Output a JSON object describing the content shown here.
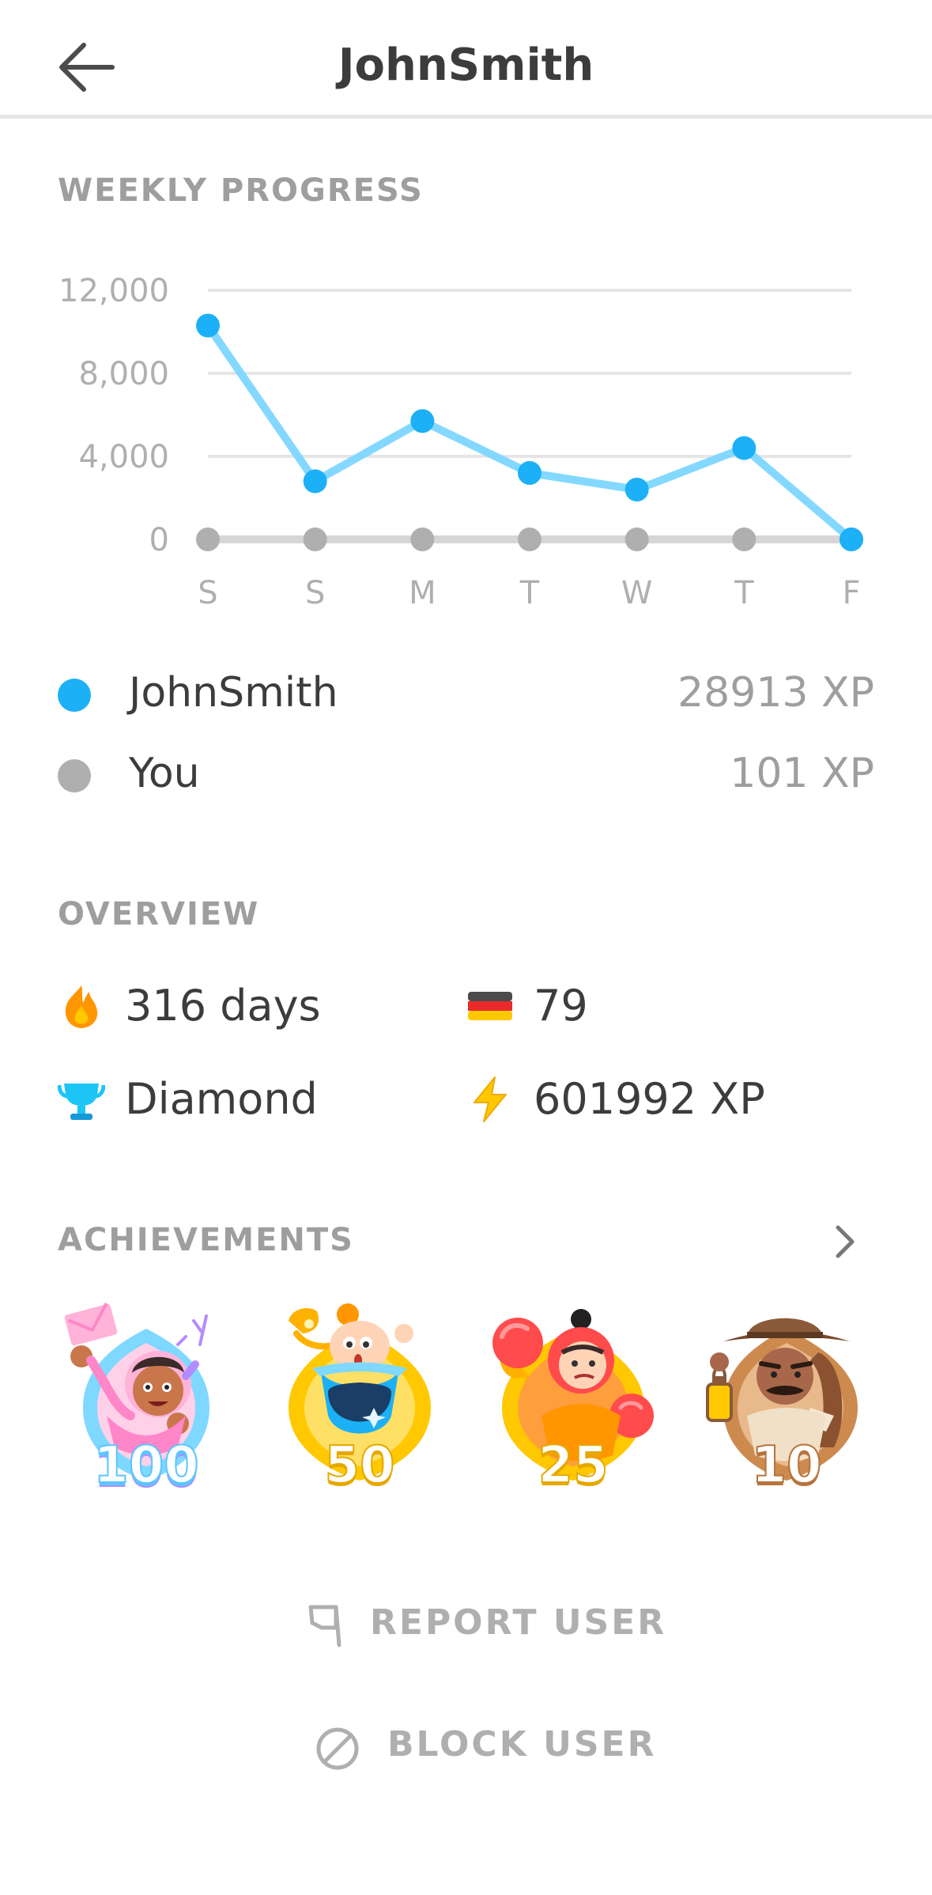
{
  "header": {
    "title": "JohnSmith",
    "back_icon": "arrow-left-icon"
  },
  "weekly_progress": {
    "label": "WEEKLY PROGRESS",
    "legend": [
      {
        "name": "JohnSmith",
        "xp": "28913 XP",
        "color": "#1cb0f6"
      },
      {
        "name": "You",
        "xp": "101 XP",
        "color": "#afafaf"
      }
    ]
  },
  "chart_data": {
    "type": "line",
    "categories": [
      "S",
      "S",
      "M",
      "T",
      "W",
      "T",
      "F"
    ],
    "y_ticks": [
      "12,000",
      "8,000",
      "4,000",
      "0"
    ],
    "ylim": [
      0,
      12000
    ],
    "grid": true,
    "series": [
      {
        "name": "JohnSmith",
        "color": "#1cb0f6",
        "line_color": "#84d8ff",
        "values": [
          10300,
          2800,
          5700,
          3200,
          2400,
          4400,
          0
        ]
      },
      {
        "name": "You",
        "color": "#afafaf",
        "line_color": "#d6d6d6",
        "values": [
          0,
          0,
          0,
          0,
          0,
          0,
          0
        ]
      }
    ]
  },
  "overview": {
    "label": "OVERVIEW",
    "stats": [
      {
        "icon": "fire-icon",
        "text": "316 days"
      },
      {
        "icon": "germany-flag-icon",
        "text": "79"
      },
      {
        "icon": "diamond-trophy-icon",
        "text": "Diamond"
      },
      {
        "icon": "lightning-icon",
        "text": "601992 XP"
      }
    ]
  },
  "achievements": {
    "label": "ACHIEVEMENTS",
    "chevron_icon": "chevron-right-icon",
    "badges": [
      {
        "level": "100",
        "icon": "wildfire-badge-icon"
      },
      {
        "level": "50",
        "icon": "sage-badge-icon"
      },
      {
        "level": "25",
        "icon": "champion-badge-icon"
      },
      {
        "level": "10",
        "icon": "explorer-badge-icon"
      }
    ]
  },
  "actions": {
    "report": {
      "label": "REPORT USER",
      "icon": "flag-icon"
    },
    "block": {
      "label": "BLOCK USER",
      "icon": "block-icon"
    }
  }
}
